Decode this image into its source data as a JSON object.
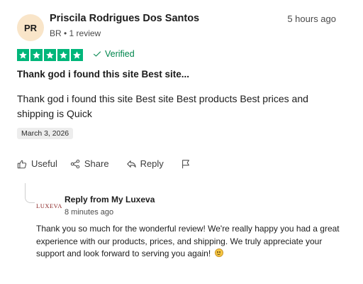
{
  "review": {
    "avatar_initials": "PR",
    "reviewer_name": "Priscila Rodrigues Dos Santos",
    "reviewer_meta": "BR • 1 review",
    "time_ago": "5 hours ago",
    "rating": 5,
    "verified_label": "Verified",
    "title": "Thank god i found this site Best site...",
    "body": "Thank god i found this site Best site Best products Best prices and shipping is Quick",
    "date": "March 3, 2026"
  },
  "actions": {
    "useful_label": "Useful",
    "share_label": "Share",
    "reply_label": "Reply"
  },
  "reply": {
    "logo_text": "LUXEVA",
    "from_label": "Reply from My Luxeva",
    "time_ago": "8 minutes ago",
    "body": "Thank you so much for the wonderful review! We're really happy you had a great experience with our products, prices, and shipping. We truly appreciate your support and look forward to serving you again!",
    "emoji_icon": "smiling-face-emoji"
  },
  "colors": {
    "star_green": "#00b67a",
    "verified_green": "#00864d",
    "avatar_bg": "#f9e5c9",
    "logo_red": "#8a2525"
  },
  "icons": {
    "star": "star-icon",
    "verified": "checkmark-icon",
    "useful": "thumbs-up-icon",
    "share": "share-icon",
    "reply": "reply-icon",
    "flag": "flag-icon"
  }
}
